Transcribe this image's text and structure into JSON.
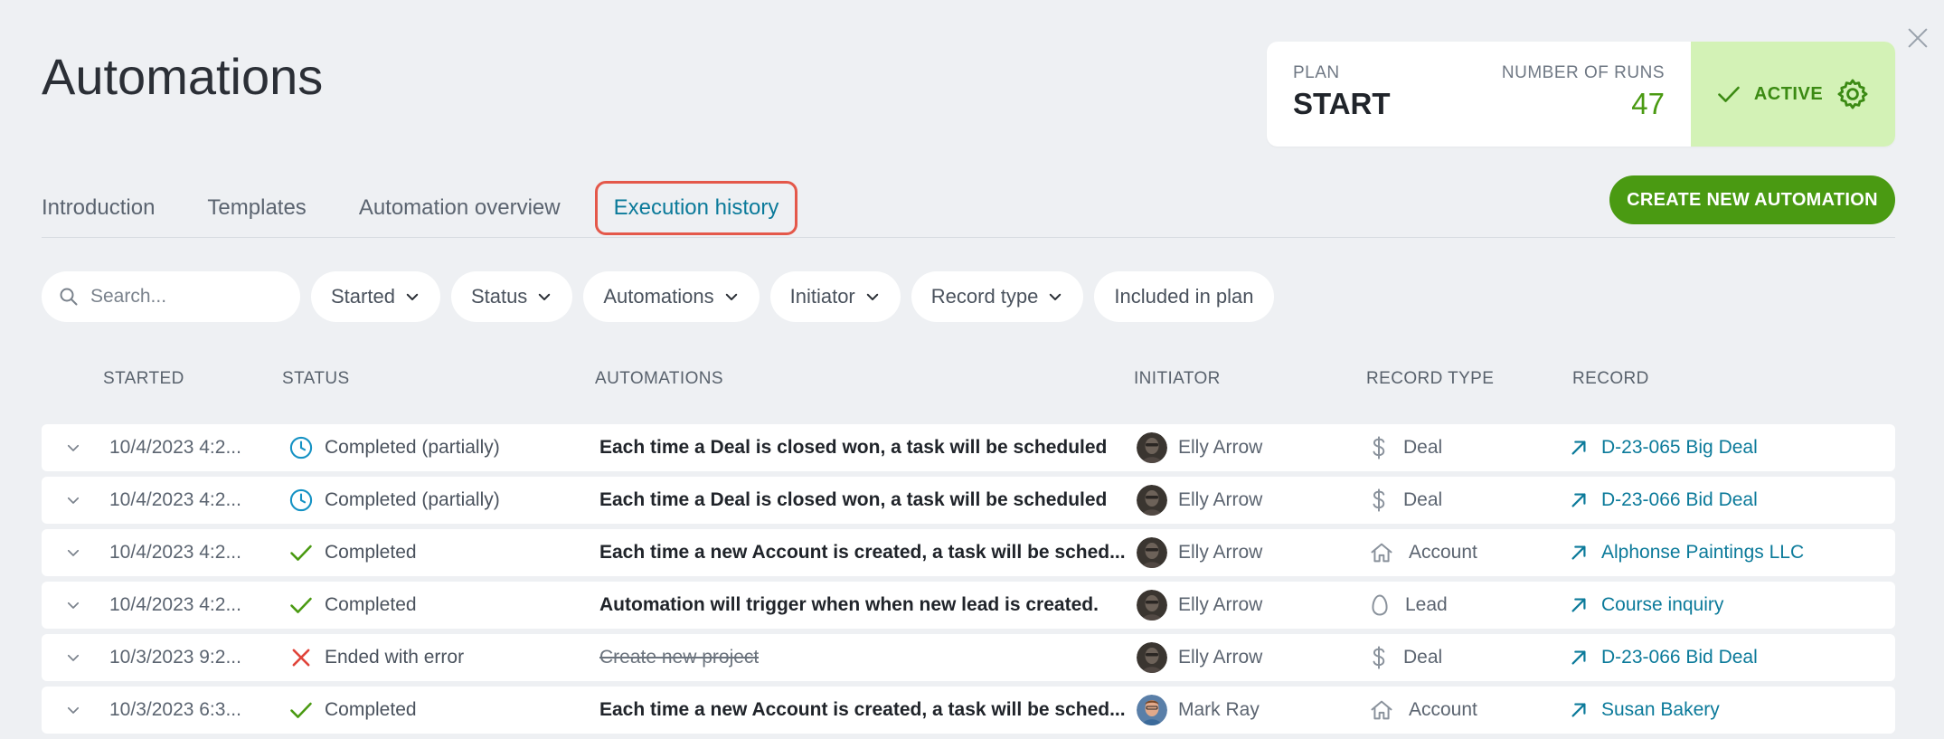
{
  "header": {
    "title": "Automations"
  },
  "plan": {
    "plan_label": "PLAN",
    "plan_value": "START",
    "runs_label": "NUMBER OF RUNS",
    "runs_value": "47",
    "status_label": "ACTIVE"
  },
  "tabs": [
    {
      "label": "Introduction",
      "active": false
    },
    {
      "label": "Templates",
      "active": false
    },
    {
      "label": "Automation overview",
      "active": false
    },
    {
      "label": "Execution history",
      "active": true
    }
  ],
  "create_button": "CREATE NEW AUTOMATION",
  "search": {
    "placeholder": "Search..."
  },
  "filters": [
    {
      "label": "Started",
      "dropdown": true
    },
    {
      "label": "Status",
      "dropdown": true
    },
    {
      "label": "Automations",
      "dropdown": true
    },
    {
      "label": "Initiator",
      "dropdown": true
    },
    {
      "label": "Record type",
      "dropdown": true
    },
    {
      "label": "Included in plan",
      "dropdown": false
    }
  ],
  "columns": [
    "STARTED",
    "STATUS",
    "AUTOMATIONS",
    "INITIATOR",
    "RECORD TYPE",
    "RECORD"
  ],
  "rows": [
    {
      "started": "10/4/2023 4:2...",
      "status": "Completed (partially)",
      "status_icon": "clock-icon",
      "automation": "Each time a Deal is closed won, a task will be scheduled",
      "strike": false,
      "initiator": "Elly Arrow",
      "avatar": "elly",
      "record_type": "Deal",
      "type_icon": "dollar-icon",
      "record": "D-23-065 Big Deal"
    },
    {
      "started": "10/4/2023 4:2...",
      "status": "Completed (partially)",
      "status_icon": "clock-icon",
      "automation": "Each time a Deal is closed won, a task will be scheduled",
      "strike": false,
      "initiator": "Elly Arrow",
      "avatar": "elly",
      "record_type": "Deal",
      "type_icon": "dollar-icon",
      "record": "D-23-066 Bid Deal"
    },
    {
      "started": "10/4/2023 4:2...",
      "status": "Completed",
      "status_icon": "check-icon",
      "automation": "Each time a new Account is created, a task will be sched...",
      "strike": false,
      "initiator": "Elly Arrow",
      "avatar": "elly",
      "record_type": "Account",
      "type_icon": "house-icon",
      "record": "Alphonse Paintings LLC"
    },
    {
      "started": "10/4/2023 4:2...",
      "status": "Completed",
      "status_icon": "check-icon",
      "automation": "Automation will trigger when when new lead is created.",
      "strike": false,
      "initiator": "Elly Arrow",
      "avatar": "elly",
      "record_type": "Lead",
      "type_icon": "egg-icon",
      "record": "Course inquiry"
    },
    {
      "started": "10/3/2023 9:2...",
      "status": "Ended with error",
      "status_icon": "error-x-icon",
      "automation": "Create new project",
      "strike": true,
      "initiator": "Elly Arrow",
      "avatar": "elly",
      "record_type": "Deal",
      "type_icon": "dollar-icon",
      "record": "D-23-066 Bid Deal"
    },
    {
      "started": "10/3/2023 6:3...",
      "status": "Completed",
      "status_icon": "check-icon",
      "automation": "Each time a new Account is created, a task will be sched...",
      "strike": false,
      "initiator": "Mark Ray",
      "avatar": "mark",
      "record_type": "Account",
      "type_icon": "house-icon",
      "record": "Susan Bakery"
    }
  ],
  "colors": {
    "accent_green": "#4a9a12",
    "link_teal": "#0b7a9a",
    "active_bg": "#d3f2b6",
    "highlight_red": "#e4584a",
    "error_red": "#e0443a",
    "clock_blue": "#1592c4"
  }
}
